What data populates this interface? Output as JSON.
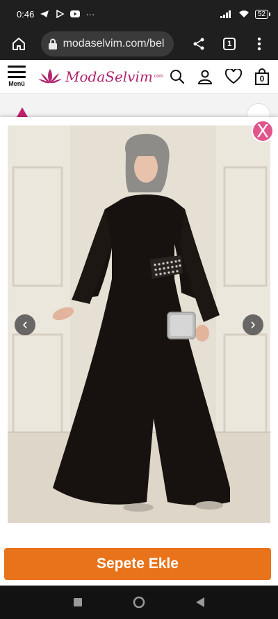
{
  "status_bar": {
    "time": "0:46",
    "battery": "52"
  },
  "browser": {
    "url": "modaselvim.com/bel",
    "tab_count": "1"
  },
  "site": {
    "menu_label": "Menü",
    "logo_text": "ModaSelvim",
    "logo_suffix": ".com",
    "cart_count": "0"
  },
  "modal": {
    "close_label": "X",
    "prev_label": "‹",
    "next_label": "›"
  },
  "cart_button": {
    "label": "Sepete Ekle"
  },
  "colors": {
    "brand": "#b1236f",
    "accent": "#e8731a",
    "close": "#e0558c"
  }
}
